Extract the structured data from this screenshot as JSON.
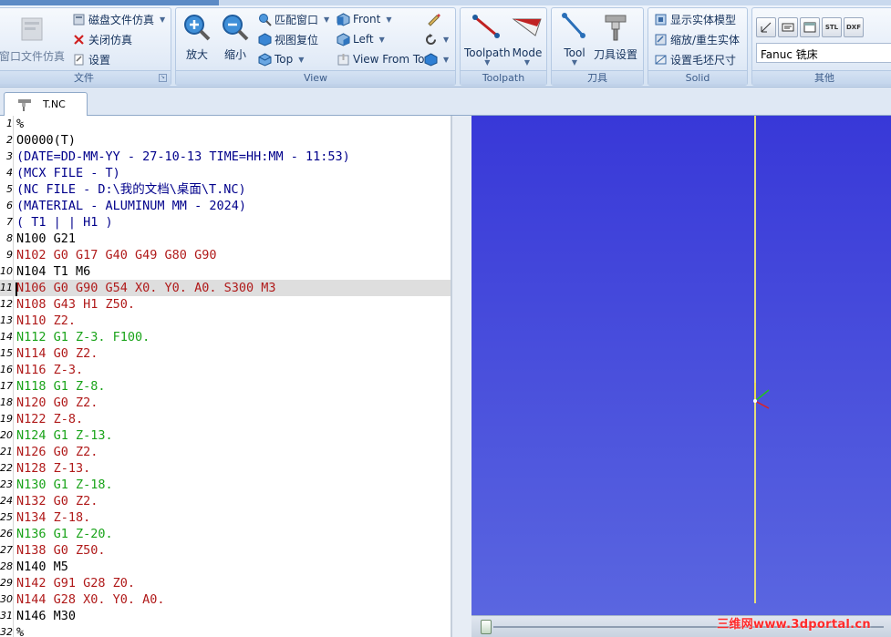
{
  "ribbon": {
    "file_group": {
      "label": "文件",
      "window_sim_label": "窗口文件仿真",
      "disk_sim_label": "磁盘文件仿真",
      "close_sim_label": "关闭仿真",
      "settings_label": "设置"
    },
    "view_group": {
      "label": "View",
      "zoom_in_label": "放大",
      "zoom_out_label": "缩小",
      "fit_window_label": "匹配窗口",
      "view_reset_label": "视图复位",
      "top_label": "Top",
      "front_label": "Front",
      "left_label": "Left",
      "view_from_tool_label": "View From Tool"
    },
    "toolpath_group": {
      "label": "Toolpath",
      "toolpath_label": "Toolpath",
      "mode_label": "Mode"
    },
    "tool_group": {
      "label": "刀具",
      "tool_label": "Tool",
      "tool_settings_label": "刀具设置"
    },
    "solid_group": {
      "label": "Solid",
      "show_solid_label": "显示实体模型",
      "zoom_regen_label": "缩放/重生实体",
      "stock_size_label": "设置毛坯尺寸"
    },
    "other_group": {
      "label": "其他",
      "dxf_label": "DXF",
      "stl_label": "STL",
      "machine_value": "Fanuc 铣床"
    }
  },
  "tab": {
    "filename": "T.NC"
  },
  "editor": {
    "lines": [
      {
        "n": "1",
        "text": "%",
        "color": "#000000"
      },
      {
        "n": "2",
        "text": "O0000(T)",
        "color": "#000000"
      },
      {
        "n": "3",
        "text": "(DATE=DD-MM-YY - 27-10-13 TIME=HH:MM - 11:53)",
        "color": "#00008b"
      },
      {
        "n": "4",
        "text": "(MCX FILE - T)",
        "color": "#00008b"
      },
      {
        "n": "5",
        "text": "(NC FILE - D:\\我的文档\\桌面\\T.NC)",
        "color": "#00008b"
      },
      {
        "n": "6",
        "text": "(MATERIAL - ALUMINUM MM - 2024)",
        "color": "#00008b"
      },
      {
        "n": "7",
        "text": "( T1 | | H1 )",
        "color": "#00008b"
      },
      {
        "n": "8",
        "text": "N100 G21",
        "color": "#000000"
      },
      {
        "n": "9",
        "text": "N102 G0 G17 G40 G49 G80 G90",
        "color": "#b01a1a"
      },
      {
        "n": "10",
        "text": "N104 T1 M6",
        "color": "#000000"
      },
      {
        "n": "11",
        "text": "N106 G0 G90 G54 X0. Y0. A0. S300 M3",
        "color": "#b01a1a"
      },
      {
        "n": "12",
        "text": "N108 G43 H1 Z50.",
        "color": "#b01a1a"
      },
      {
        "n": "13",
        "text": "N110 Z2.",
        "color": "#b01a1a"
      },
      {
        "n": "14",
        "text": "N112 G1 Z-3. F100.",
        "color": "#19a319"
      },
      {
        "n": "15",
        "text": "N114 G0 Z2.",
        "color": "#b01a1a"
      },
      {
        "n": "16",
        "text": "N116 Z-3.",
        "color": "#b01a1a"
      },
      {
        "n": "17",
        "text": "N118 G1 Z-8.",
        "color": "#19a319"
      },
      {
        "n": "18",
        "text": "N120 G0 Z2.",
        "color": "#b01a1a"
      },
      {
        "n": "19",
        "text": "N122 Z-8.",
        "color": "#b01a1a"
      },
      {
        "n": "20",
        "text": "N124 G1 Z-13.",
        "color": "#19a319"
      },
      {
        "n": "21",
        "text": "N126 G0 Z2.",
        "color": "#b01a1a"
      },
      {
        "n": "22",
        "text": "N128 Z-13.",
        "color": "#b01a1a"
      },
      {
        "n": "23",
        "text": "N130 G1 Z-18.",
        "color": "#19a319"
      },
      {
        "n": "24",
        "text": "N132 G0 Z2.",
        "color": "#b01a1a"
      },
      {
        "n": "25",
        "text": "N134 Z-18.",
        "color": "#b01a1a"
      },
      {
        "n": "26",
        "text": "N136 G1 Z-20.",
        "color": "#19a319"
      },
      {
        "n": "27",
        "text": "N138 G0 Z50.",
        "color": "#b01a1a"
      },
      {
        "n": "28",
        "text": "N140 M5",
        "color": "#000000"
      },
      {
        "n": "29",
        "text": "N142 G91 G28 Z0.",
        "color": "#b01a1a"
      },
      {
        "n": "30",
        "text": "N144 G28 X0. Y0. A0.",
        "color": "#b01a1a"
      },
      {
        "n": "31",
        "text": "N146 M30",
        "color": "#000000"
      },
      {
        "n": "32",
        "text": "%",
        "color": "#000000"
      }
    ],
    "current_line": "11"
  },
  "viewport": {
    "watermark": "三维网www.3dportal.cn"
  },
  "colors": {
    "ribbon_bg": "#dfe8f4",
    "viewport_top": "#3838d8",
    "viewport_bottom": "#5a66e0",
    "tool_line": "#d8d26a"
  }
}
